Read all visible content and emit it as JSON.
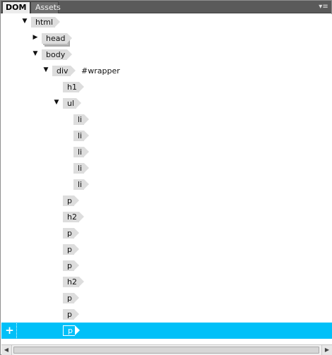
{
  "tabs": [
    {
      "label": "DOM",
      "active": true
    },
    {
      "label": "Assets",
      "active": false
    }
  ],
  "panel_menu": {
    "icon": "panel-menu-icon",
    "glyph": "▾≡"
  },
  "tree": {
    "selection_color": "#00c0f8",
    "nodes": [
      {
        "tag": "html",
        "toggle": "expanded",
        "depth": 0
      },
      {
        "tag": "head",
        "toggle": "collapsed",
        "depth": 1
      },
      {
        "tag": "body",
        "toggle": "expanded",
        "depth": 1
      },
      {
        "tag": "div",
        "toggle": "expanded",
        "depth": 2,
        "id": "#wrapper"
      },
      {
        "tag": "h1",
        "depth": 3
      },
      {
        "tag": "ul",
        "toggle": "expanded",
        "depth": 3
      },
      {
        "tag": "li",
        "depth": 4
      },
      {
        "tag": "li",
        "depth": 4
      },
      {
        "tag": "li",
        "depth": 4
      },
      {
        "tag": "li",
        "depth": 4
      },
      {
        "tag": "li",
        "depth": 4
      },
      {
        "tag": "p",
        "depth": 3
      },
      {
        "tag": "h2",
        "depth": 3
      },
      {
        "tag": "p",
        "depth": 3
      },
      {
        "tag": "p",
        "depth": 3
      },
      {
        "tag": "p",
        "depth": 3
      },
      {
        "tag": "h2",
        "depth": 3
      },
      {
        "tag": "p",
        "depth": 3
      },
      {
        "tag": "p",
        "depth": 3
      },
      {
        "tag": "p",
        "depth": 3,
        "selected": true
      }
    ]
  },
  "add_button": {
    "glyph": "+",
    "icon": "plus-icon"
  },
  "scrollbar": {
    "left_glyph": "◀",
    "right_glyph": "▶"
  }
}
